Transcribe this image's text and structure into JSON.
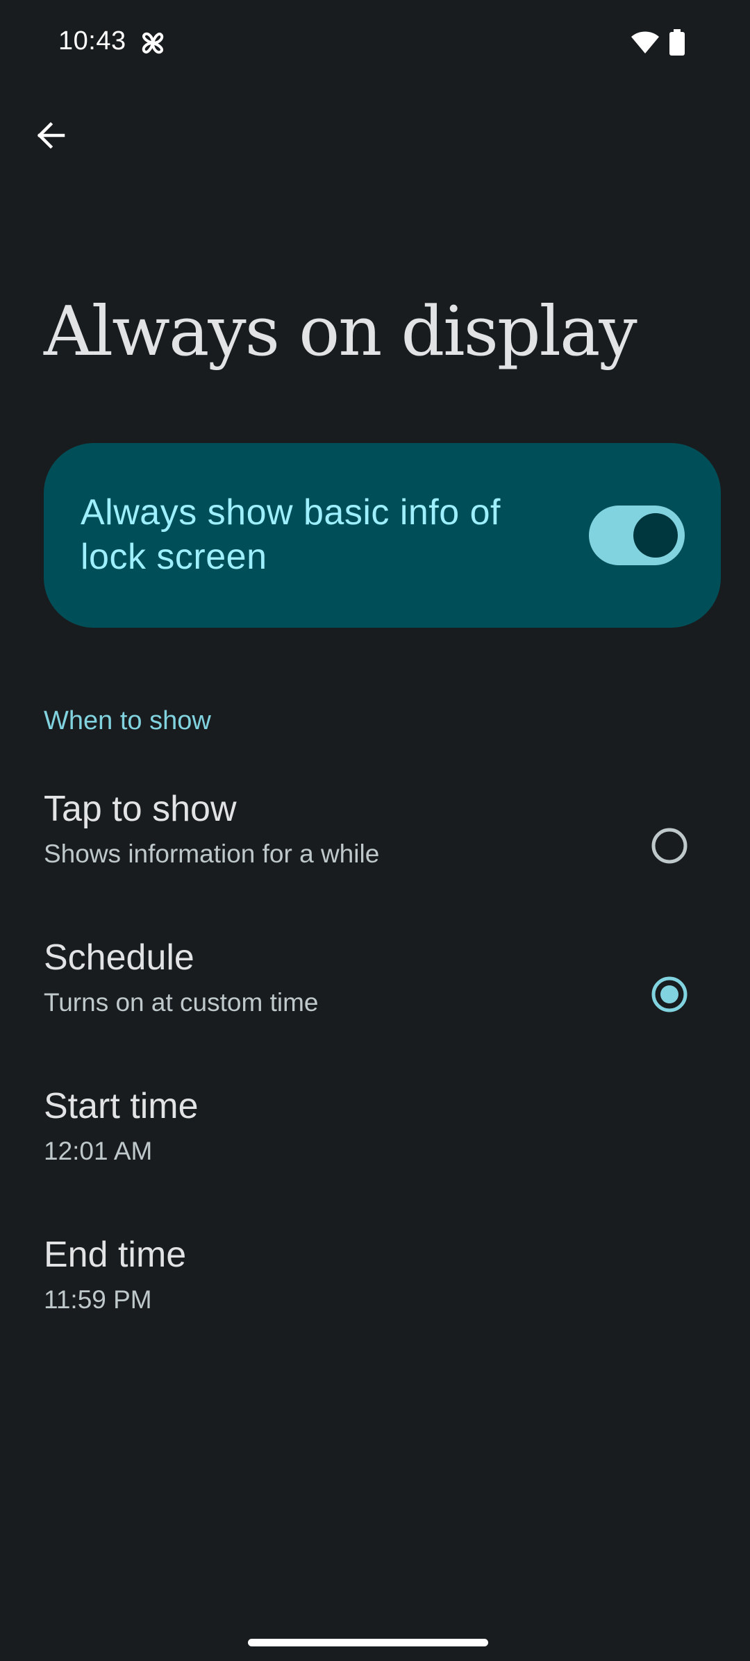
{
  "status_bar": {
    "time": "10:43",
    "app_icon": "pinwheel-icon",
    "wifi_icon": "wifi-icon",
    "battery_icon": "battery-icon"
  },
  "toolbar": {
    "back_icon": "arrow-back-icon"
  },
  "page": {
    "title": "Always on display"
  },
  "main_toggle": {
    "label": "Always show basic info of lock screen",
    "checked": true
  },
  "section": {
    "header": "When to show"
  },
  "options": [
    {
      "title": "Tap to show",
      "subtitle": "Shows information for a while",
      "selected": false
    },
    {
      "title": "Schedule",
      "subtitle": "Turns on at custom time",
      "selected": true
    }
  ],
  "times": {
    "start": {
      "title": "Start time",
      "value": "12:01 AM"
    },
    "end": {
      "title": "End time",
      "value": "11:59 PM"
    }
  },
  "colors": {
    "background": "#191c1e",
    "card": "#004f58",
    "accent": "#82d3e0",
    "card_text": "#9ef0ff"
  }
}
